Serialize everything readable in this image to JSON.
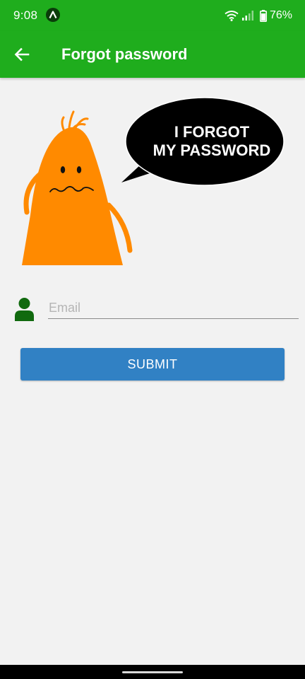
{
  "status_bar": {
    "time": "9:08",
    "battery": "76%",
    "icons": [
      "app-notification-icon",
      "wifi-icon",
      "signal-icon",
      "battery-icon"
    ]
  },
  "app_bar": {
    "title": "Forgot password",
    "back_icon": "arrow-left-icon",
    "background_color": "#1fad1d"
  },
  "illustration": {
    "speech_bubble_text": [
      "I FORGOT",
      "MY PASSWORD"
    ],
    "character_color": "#ff8a00"
  },
  "form": {
    "email_placeholder": "Email",
    "email_value": "",
    "field_icon": "person-icon",
    "field_icon_color": "#116a0f",
    "submit_label": "SUBMIT",
    "submit_color": "#3181c4"
  }
}
